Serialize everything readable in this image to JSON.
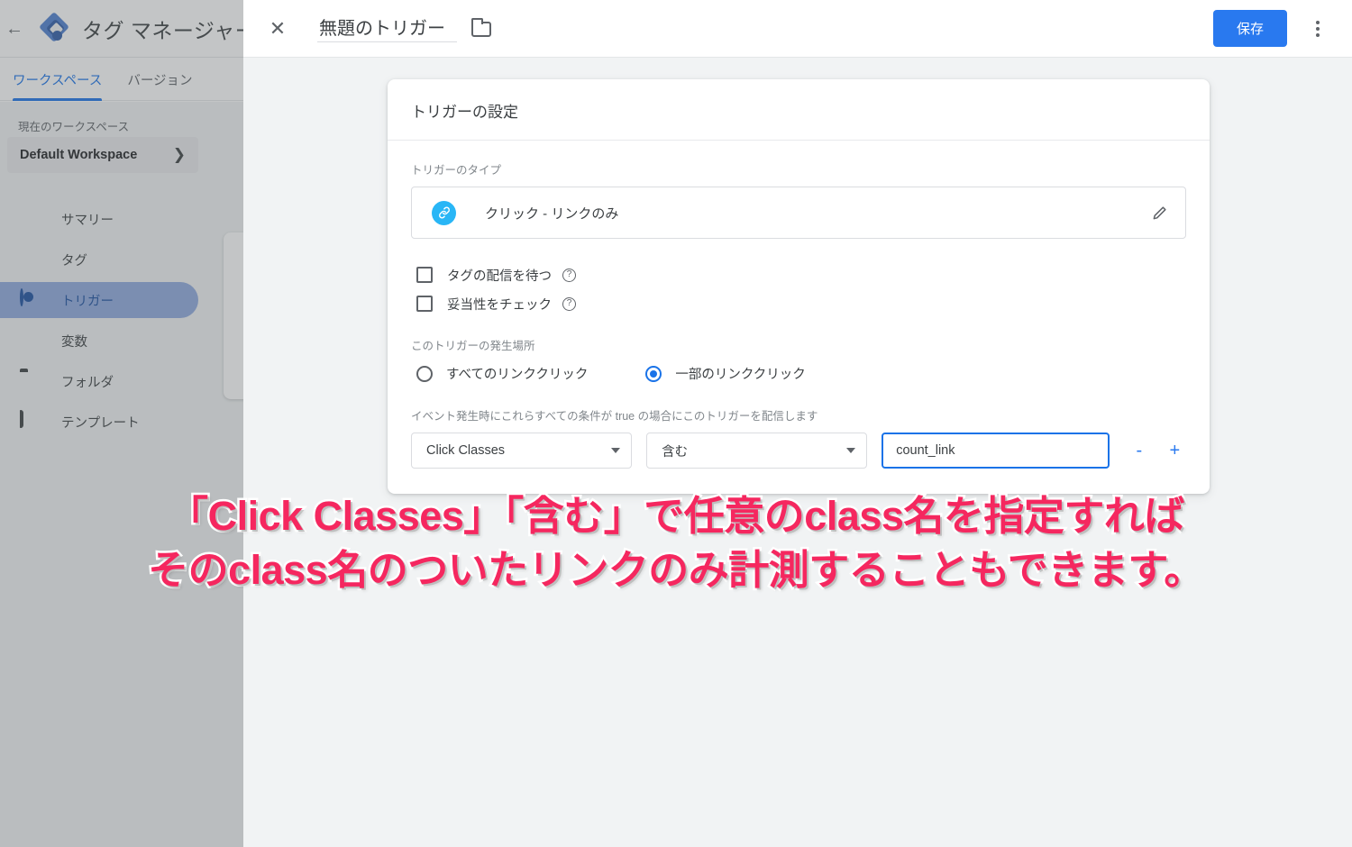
{
  "background_app": {
    "back_icon": "back-arrow-icon",
    "logo_icon": "gtm-logo-icon",
    "brand": "タグ マネージャー",
    "tabs": [
      {
        "label": "ワークスペース",
        "active": true
      },
      {
        "label": "バージョン",
        "active": false
      }
    ],
    "workspace_section_label": "現在のワークスペース",
    "workspace_name": "Default Workspace",
    "workspace_chevron": "chevron-right-icon",
    "nav_items": [
      {
        "label": "サマリー",
        "icon": "summary-icon",
        "active": false
      },
      {
        "label": "タグ",
        "icon": "tag-icon",
        "active": false
      },
      {
        "label": "トリガー",
        "icon": "trigger-icon",
        "active": true
      },
      {
        "label": "変数",
        "icon": "variable-icon",
        "active": false
      },
      {
        "label": "フォルダ",
        "icon": "folder-icon",
        "active": false
      },
      {
        "label": "テンプレート",
        "icon": "template-icon",
        "active": false
      }
    ]
  },
  "modal": {
    "close_icon": "close-icon",
    "title_value": "無題のトリガー",
    "title_placeholder": "無題のトリガー",
    "folder_icon": "folder-icon",
    "save_label": "保存",
    "more_icon": "more-vertical-icon"
  },
  "card": {
    "title": "トリガーの設定",
    "type_label": "トリガーのタイプ",
    "type_icon": "link-icon",
    "type_name": "クリック - リンクのみ",
    "edit_icon": "pencil-icon",
    "checkboxes": [
      {
        "label": "タグの配信を待つ",
        "checked": false,
        "help_icon": "help-icon"
      },
      {
        "label": "妥当性をチェック",
        "checked": false,
        "help_icon": "help-icon"
      }
    ],
    "where_label": "このトリガーの発生場所",
    "radios": [
      {
        "label": "すべてのリンククリック",
        "checked": false
      },
      {
        "label": "一部のリンククリック",
        "checked": true
      }
    ],
    "condition_description": "イベント発生時にこれらすべての条件が true の場合にこのトリガーを配信します",
    "condition": {
      "variable": "Click Classes",
      "operator": "含む",
      "value": "count_link",
      "value_placeholder": "",
      "remove_label": "-",
      "add_label": "+"
    }
  },
  "caption": {
    "line1": "「Click Classes」「含む」で任意のclass名を指定すれば",
    "line2": "そのclass名のついたリンクのみ計測することもできます。"
  },
  "colors": {
    "accent_blue": "#2979ef",
    "link_blue": "#1a73e8",
    "type_icon_blue": "#29b6f6",
    "page_bg": "#f1f3f4",
    "caption_pink": "#f5275f",
    "nav_active_bg": "#8faade"
  }
}
